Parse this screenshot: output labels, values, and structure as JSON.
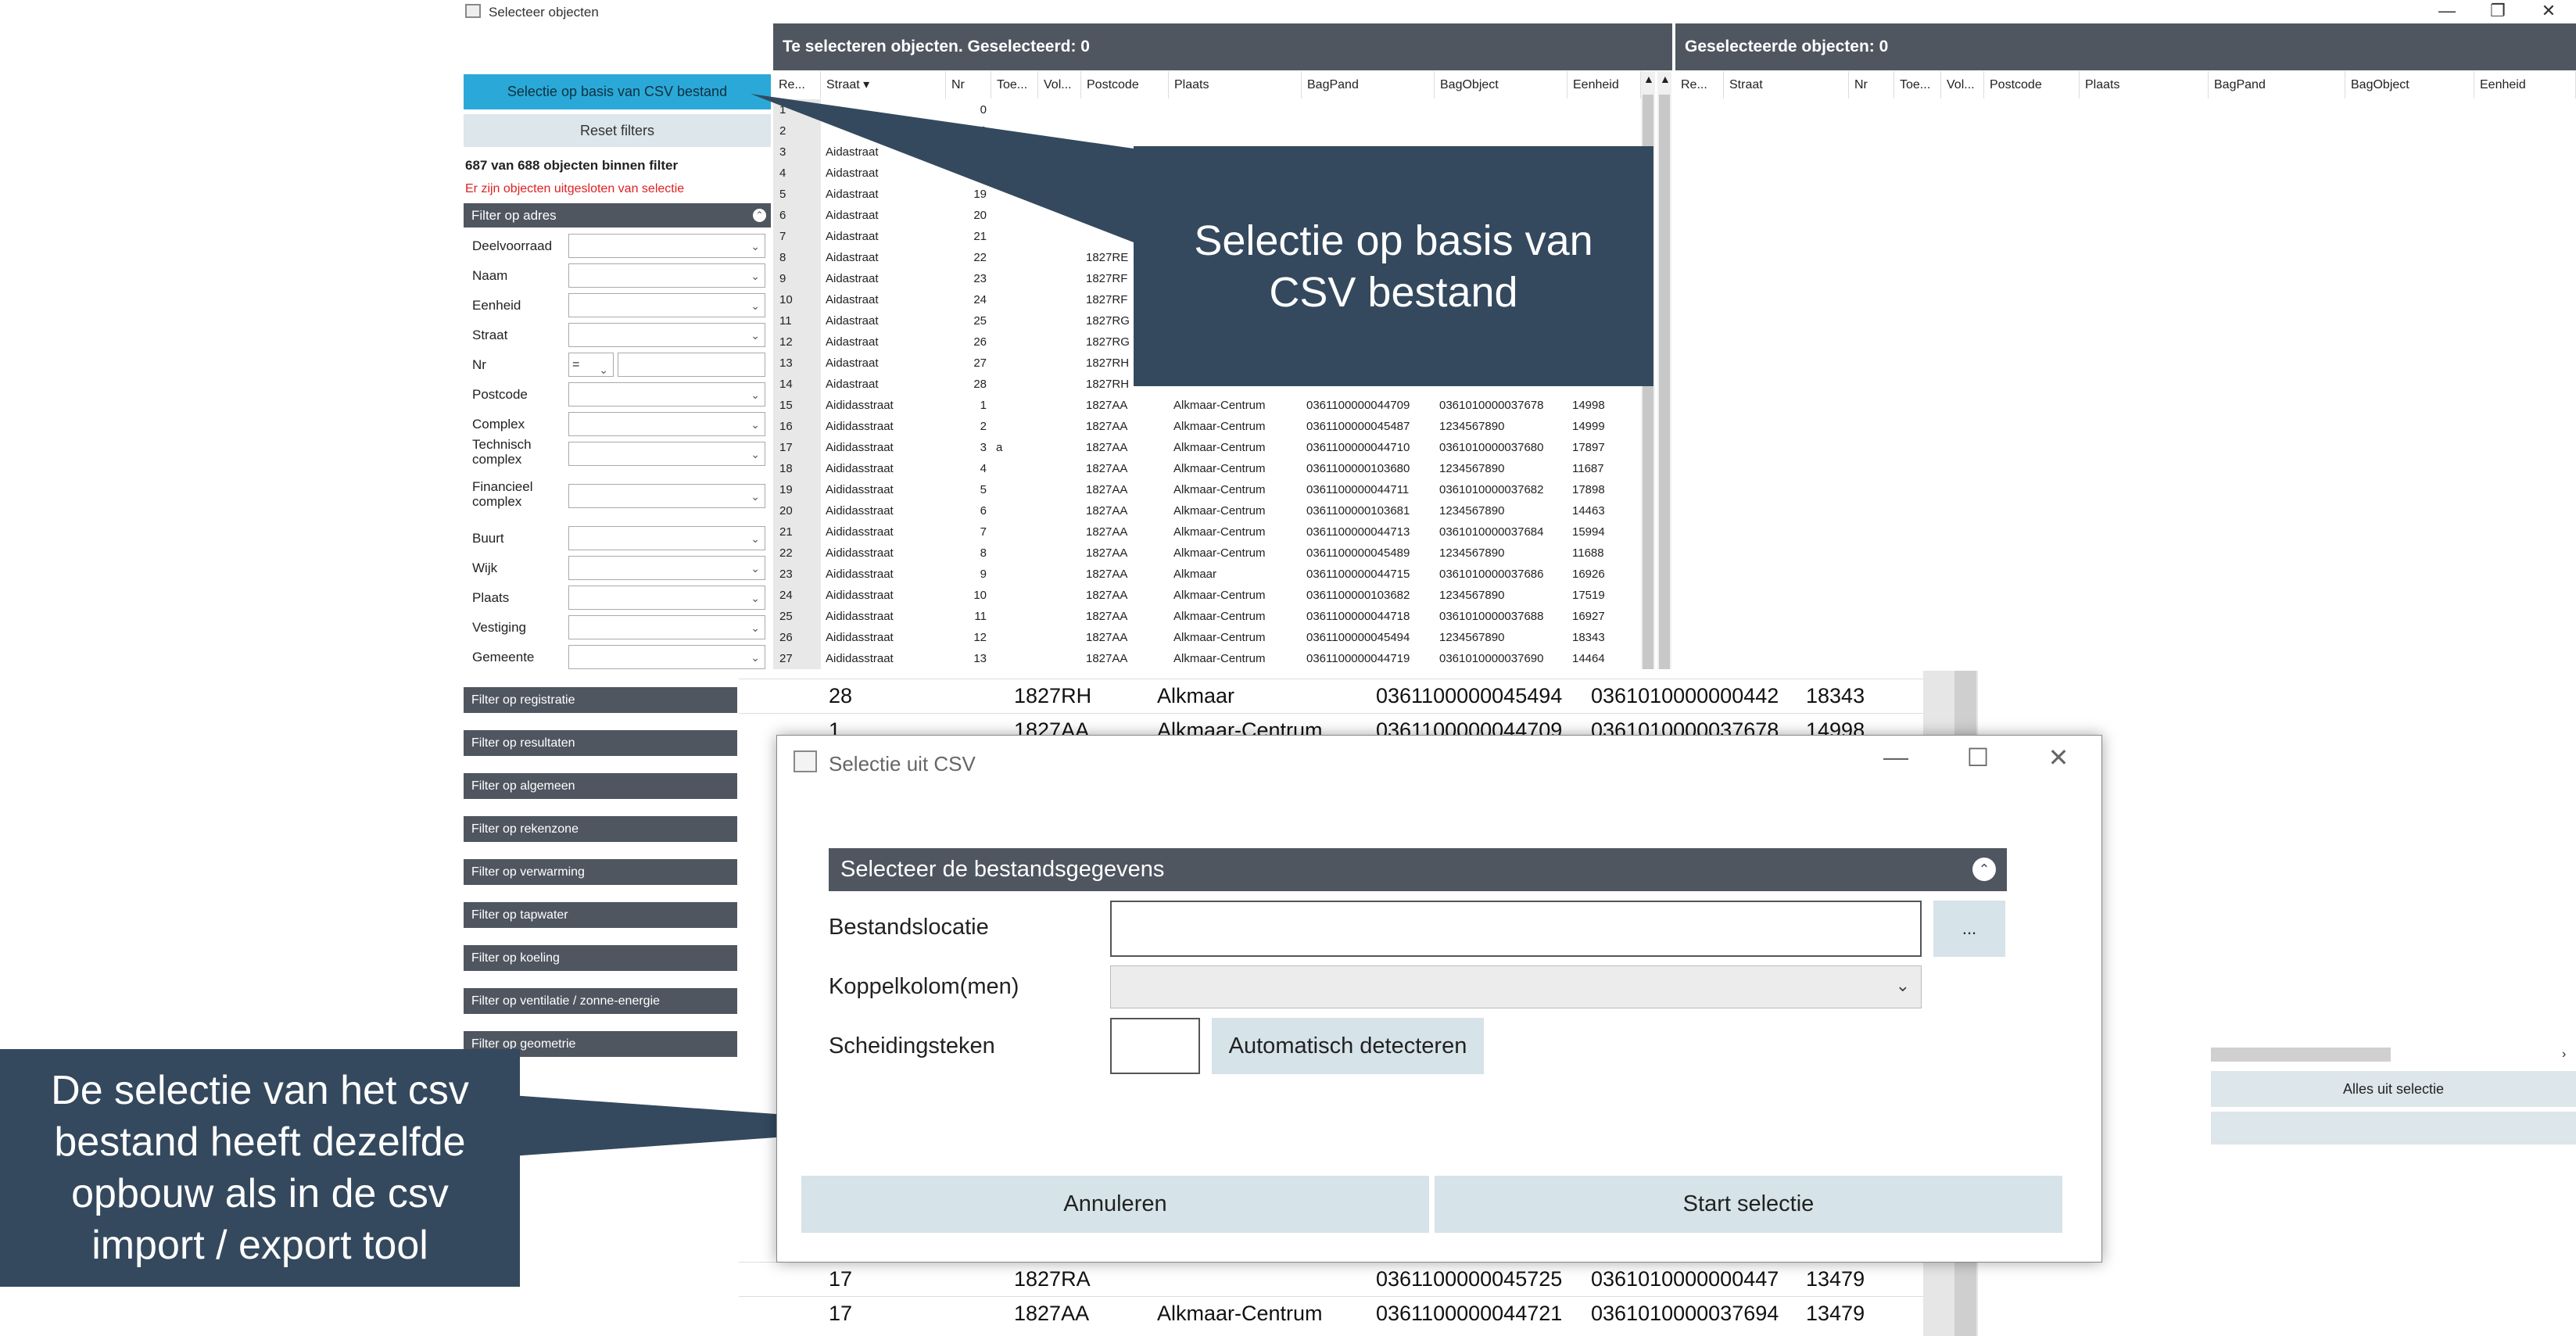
{
  "window": {
    "title": "Selecteer objecten",
    "minimize": "—",
    "restore": "❐",
    "close": "✕"
  },
  "left": {
    "csv_button": "Selectie op basis van CSV bestand",
    "reset_button": "Reset filters",
    "count_text": "687 van 688 objecten binnen filter",
    "warning_text": "Er zijn objecten uitgesloten van selectie",
    "address_filter": {
      "title": "Filter op adres",
      "fields": [
        "Deelvoorraad",
        "Naam",
        "Eenheid",
        "Straat",
        "Nr",
        "Postcode",
        "Complex",
        "Technisch complex",
        "Financieel complex",
        "Buurt",
        "Wijk",
        "Plaats",
        "Vestiging",
        "Gemeente"
      ],
      "nr_operator": "="
    },
    "collapsed_filters": [
      "Filter op registratie",
      "Filter op resultaten",
      "Filter op algemeen",
      "Filter op rekenzone",
      "Filter op verwarming",
      "Filter op tapwater",
      "Filter op koeling",
      "Filter op ventilatie / zonne-energie",
      "Filter op geometrie"
    ]
  },
  "grid_left": {
    "header": "Te selecteren objecten. Geselecteerd: 0",
    "columns": [
      "Re...",
      "Straat ▾",
      "Nr",
      "Toe...",
      "Vol...",
      "Postcode",
      "Plaats",
      "BagPand",
      "BagObject",
      "Eenheid"
    ],
    "rows": [
      [
        "1",
        "",
        "0",
        "",
        "",
        "",
        "",
        "",
        "",
        ""
      ],
      [
        "2",
        "",
        "0",
        "",
        "",
        "",
        "",
        "",
        "",
        ""
      ],
      [
        "3",
        "Aidastraat",
        "",
        "",
        "",
        "1827RB",
        "",
        "",
        "",
        ""
      ],
      [
        "4",
        "Aidastraat",
        "",
        "",
        "",
        "1827RB",
        "",
        "",
        "",
        ""
      ],
      [
        "5",
        "Aidastraat",
        "19",
        "",
        "",
        "",
        "",
        "",
        "",
        ""
      ],
      [
        "6",
        "Aidastraat",
        "20",
        "",
        "",
        "",
        "",
        "",
        "",
        ""
      ],
      [
        "7",
        "Aidastraat",
        "21",
        "",
        "",
        "",
        "",
        "",
        "",
        ""
      ],
      [
        "8",
        "Aidastraat",
        "22",
        "",
        "",
        "1827RE",
        "",
        "",
        "",
        ""
      ],
      [
        "9",
        "Aidastraat",
        "23",
        "",
        "",
        "1827RF",
        "",
        "",
        "",
        ""
      ],
      [
        "10",
        "Aidastraat",
        "24",
        "",
        "",
        "1827RF",
        "",
        "",
        "",
        ""
      ],
      [
        "11",
        "Aidastraat",
        "25",
        "",
        "",
        "1827RG",
        "",
        "",
        "",
        ""
      ],
      [
        "12",
        "Aidastraat",
        "26",
        "",
        "",
        "1827RG",
        "",
        "",
        "",
        ""
      ],
      [
        "13",
        "Aidastraat",
        "27",
        "",
        "",
        "1827RH",
        "",
        "",
        "",
        ""
      ],
      [
        "14",
        "Aidastraat",
        "28",
        "",
        "",
        "1827RH",
        "",
        "",
        "",
        ""
      ],
      [
        "15",
        "Aididasstraat",
        "1",
        "",
        "",
        "1827AA",
        "Alkmaar-Centrum",
        "0361100000044709",
        "0361010000037678",
        "14998"
      ],
      [
        "16",
        "Aididasstraat",
        "2",
        "",
        "",
        "1827AA",
        "Alkmaar-Centrum",
        "0361100000045487",
        "1234567890",
        "14999"
      ],
      [
        "17",
        "Aididasstraat",
        "3",
        "a",
        "",
        "1827AA",
        "Alkmaar-Centrum",
        "0361100000044710",
        "0361010000037680",
        "17897"
      ],
      [
        "18",
        "Aididasstraat",
        "4",
        "",
        "",
        "1827AA",
        "Alkmaar-Centrum",
        "0361100000103680",
        "1234567890",
        "11687"
      ],
      [
        "19",
        "Aididasstraat",
        "5",
        "",
        "",
        "1827AA",
        "Alkmaar-Centrum",
        "0361100000044711",
        "0361010000037682",
        "17898"
      ],
      [
        "20",
        "Aididasstraat",
        "6",
        "",
        "",
        "1827AA",
        "Alkmaar-Centrum",
        "0361100000103681",
        "1234567890",
        "14463"
      ],
      [
        "21",
        "Aididasstraat",
        "7",
        "",
        "",
        "1827AA",
        "Alkmaar-Centrum",
        "0361100000044713",
        "0361010000037684",
        "15994"
      ],
      [
        "22",
        "Aididasstraat",
        "8",
        "",
        "",
        "1827AA",
        "Alkmaar-Centrum",
        "0361100000045489",
        "1234567890",
        "11688"
      ],
      [
        "23",
        "Aididasstraat",
        "9",
        "",
        "",
        "1827AA",
        "Alkmaar",
        "0361100000044715",
        "0361010000037686",
        "16926"
      ],
      [
        "24",
        "Aididasstraat",
        "10",
        "",
        "",
        "1827AA",
        "Alkmaar-Centrum",
        "0361100000103682",
        "1234567890",
        "17519"
      ],
      [
        "25",
        "Aididasstraat",
        "11",
        "",
        "",
        "1827AA",
        "Alkmaar-Centrum",
        "0361100000044718",
        "0361010000037688",
        "16927"
      ],
      [
        "26",
        "Aididasstraat",
        "12",
        "",
        "",
        "1827AA",
        "Alkmaar-Centrum",
        "0361100000045494",
        "1234567890",
        "18343"
      ],
      [
        "27",
        "Aididasstraat",
        "13",
        "",
        "",
        "1827AA",
        "Alkmaar-Centrum",
        "0361100000044719",
        "0361010000037690",
        "14464"
      ]
    ]
  },
  "grid_right": {
    "header": "Geselecteerde objecten: 0",
    "columns": [
      "Re...",
      "Straat",
      "Nr",
      "Toe...",
      "Vol...",
      "Postcode",
      "Plaats",
      "BagPand",
      "BagObject",
      "Eenheid"
    ],
    "remove_all_button": "Alles uit selectie"
  },
  "zoom_rows": [
    [
      "28",
      "1827RH",
      "Alkmaar",
      "0361100000045494",
      "0361010000000442",
      "18343"
    ],
    [
      "1",
      "1827AA",
      "Alkmaar-Centrum",
      "0361100000044709",
      "0361010000037678",
      "14998"
    ],
    [
      "17",
      "1827RA",
      "",
      "0361100000045725",
      "0361010000000447",
      "13479"
    ],
    [
      "17",
      "1827AA",
      "Alkmaar-Centrum",
      "0361100000044721",
      "0361010000037694",
      "13479"
    ]
  ],
  "dialog": {
    "title": "Selectie uit CSV",
    "section": "Selecteer de bestandsgegevens",
    "file_label": "Bestandslocatie",
    "file_value": "",
    "browse": "...",
    "key_label": "Koppelkolom(men)",
    "sep_label": "Scheidingsteken",
    "sep_value": "",
    "detect_button": "Automatisch detecteren",
    "cancel_button": "Annuleren",
    "start_button": "Start selectie",
    "minimize": "—",
    "maximize": "☐",
    "close": "✕"
  },
  "callouts": {
    "top": "Selectie op basis van CSV bestand",
    "bottom": "De selectie van het csv bestand heeft dezelfde opbouw als in de csv import / export tool"
  }
}
